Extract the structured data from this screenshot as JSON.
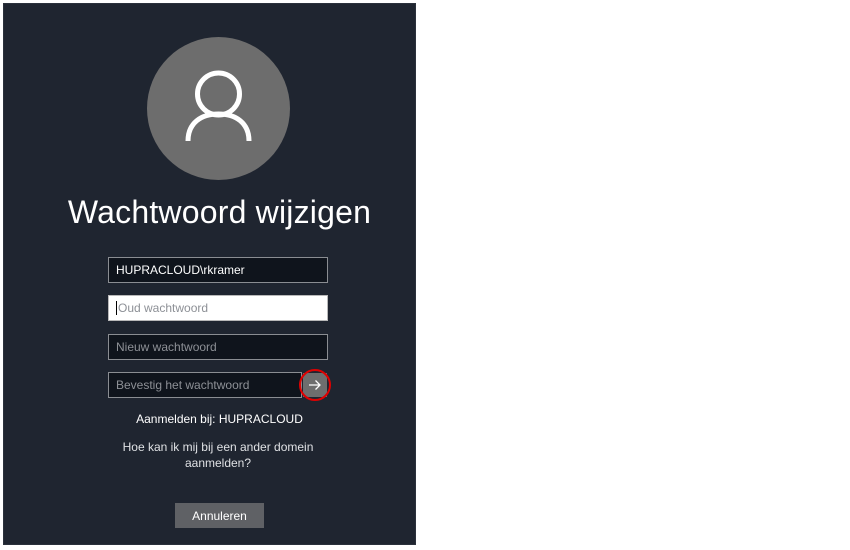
{
  "title": "Wachtwoord wijzigen",
  "form": {
    "username_value": "HUPRACLOUD\\rkramer",
    "old_password_placeholder": "Oud wachtwoord",
    "new_password_placeholder": "Nieuw wachtwoord",
    "confirm_password_placeholder": "Bevestig het wachtwoord"
  },
  "signin_to": "Aanmelden bij: HUPRACLOUD",
  "other_domain": {
    "line1": "Hoe kan ik mij bij een ander domein",
    "line2": "aanmelden?"
  },
  "cancel_label": "Annuleren",
  "icons": {
    "avatar": "user-icon",
    "submit": "arrow-right-icon"
  },
  "colors": {
    "panel_bg": "#1f2530",
    "avatar_bg": "#6d6d6d",
    "highlight": "#e00000"
  }
}
